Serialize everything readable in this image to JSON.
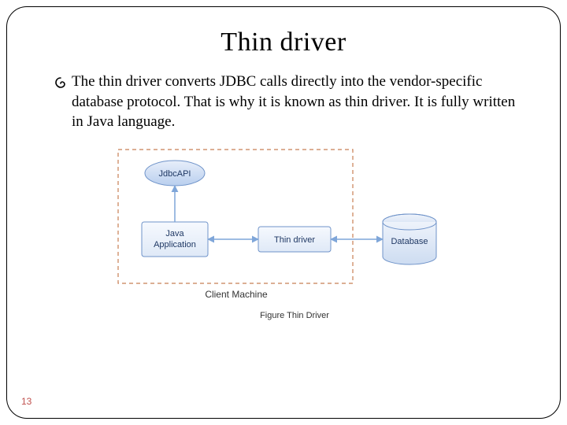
{
  "title": "Thin driver",
  "bullet": {
    "text": "The thin driver converts JDBC calls directly into the vendor-specific database protocol. That is why it is known as thin driver. It is fully written in Java language."
  },
  "diagram": {
    "box_jdbc": "JdbcAPI",
    "box_app_line1": "Java",
    "box_app_line2": "Application",
    "box_thin": "Thin driver",
    "box_db": "Database",
    "client_label": "Client Machine",
    "caption": "Figure  Thin Driver"
  },
  "page_number": "13"
}
